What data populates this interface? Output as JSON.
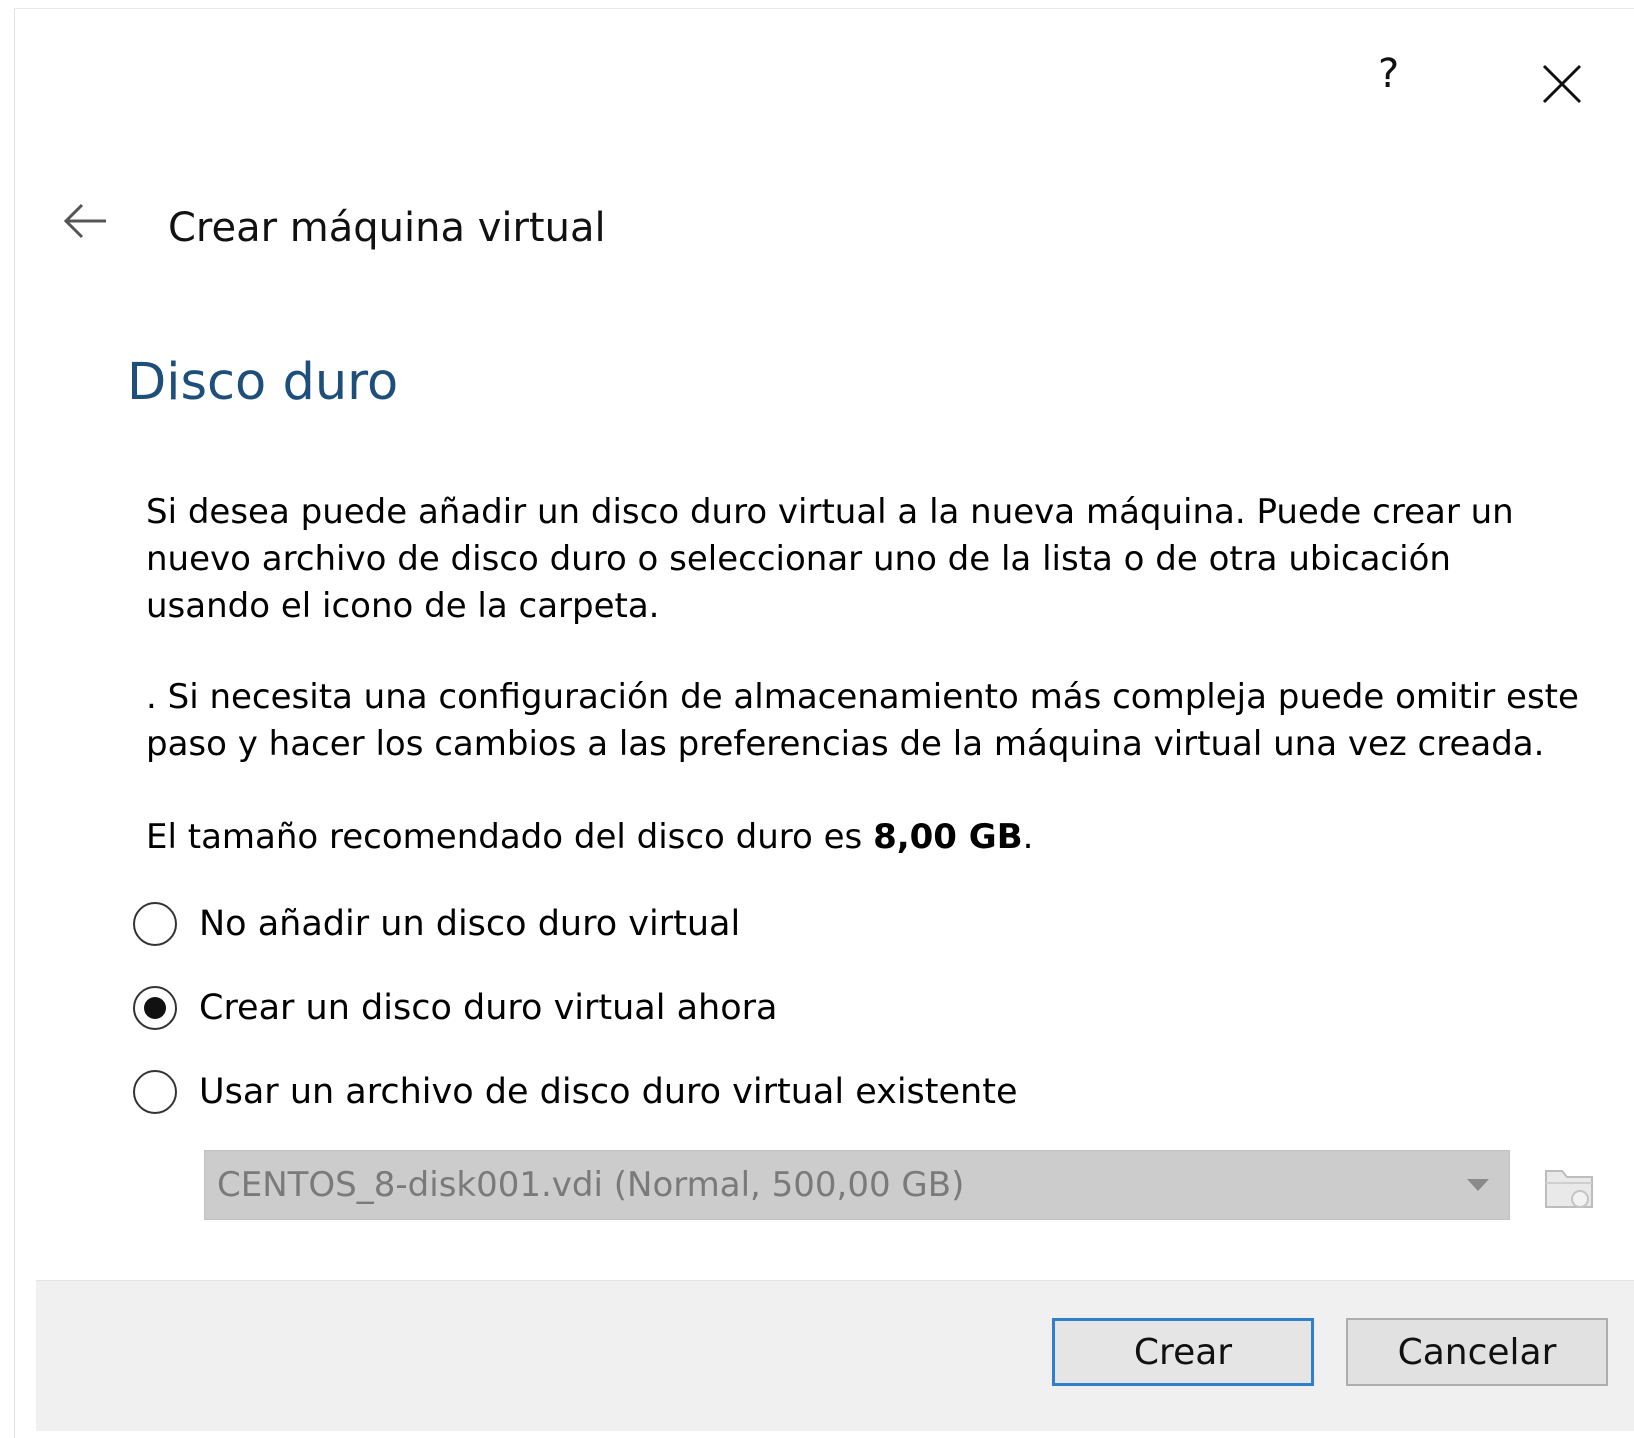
{
  "titlebar": {
    "help_label": "?",
    "close_icon": "close-icon"
  },
  "header": {
    "back_icon": "back-arrow-icon",
    "title": "Crear máquina virtual"
  },
  "section": {
    "title": "Disco duro",
    "paragraph1": [
      "Si desea puede añadir un disco duro virtual a la nueva máquina. Puede crear un",
      "nuevo archivo de disco duro o seleccionar uno de la lista o de otra ubicación",
      "usando el icono de la carpeta."
    ],
    "paragraph2": [
      ". Si necesita una configuración de almacenamiento más compleja puede omitir este",
      "paso y hacer los cambios a las preferencias de la máquina virtual una vez creada."
    ],
    "recommended_prefix": "El tamaño recomendado del disco duro es ",
    "recommended_size": "8,00 GB",
    "recommended_suffix": "."
  },
  "options": [
    {
      "label": "No añadir un disco duro virtual",
      "checked": false
    },
    {
      "label": "Crear un disco duro virtual ahora",
      "checked": true
    },
    {
      "label": "Usar un archivo de disco duro virtual existente",
      "checked": false
    }
  ],
  "disk_select": {
    "value": "CENTOS_8-disk001.vdi (Normal, 500,00 GB)",
    "enabled": false,
    "folder_icon": "folder-icon"
  },
  "footer": {
    "create_label": "Crear",
    "cancel_label": "Cancelar"
  },
  "colors": {
    "section_title": "#1e4f7a",
    "default_button_border": "#2f7fd1",
    "footer_bg": "#f0f0f0",
    "disabled_select_bg": "#cccccc"
  }
}
